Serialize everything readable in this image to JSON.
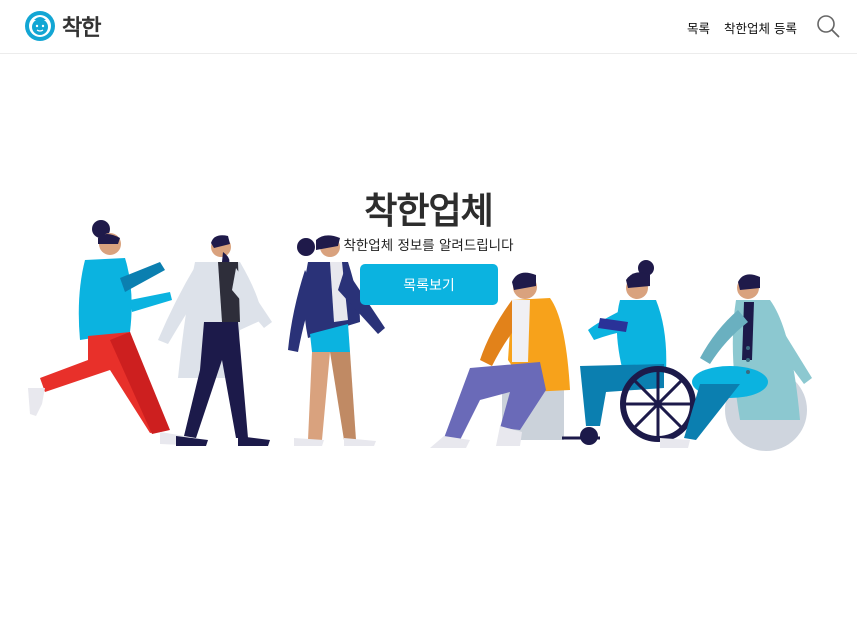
{
  "header": {
    "logo_text": "착한",
    "nav": [
      "목록",
      "착한업체 등록"
    ]
  },
  "hero": {
    "title": "착한업체",
    "subtitle": "착한업체 정보를 알려드립니다",
    "button_label": "목록보기"
  },
  "colors": {
    "accent": "#0bb3e0",
    "text": "#2d2d2d"
  },
  "icons": [
    "logo-face-icon",
    "search-icon"
  ]
}
